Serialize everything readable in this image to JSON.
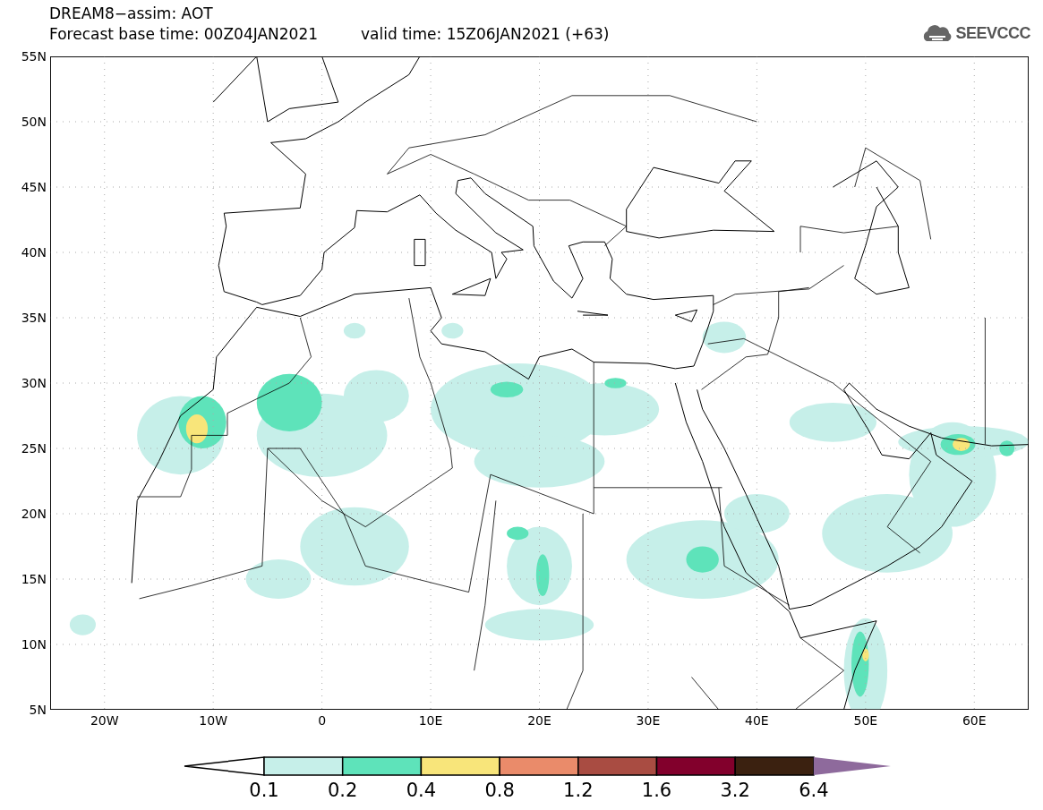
{
  "title": "DREAM8−assim: AOT",
  "base_time": "Forecast base time: 00Z04JAN2021",
  "valid_time": "valid time: 15Z06JAN2021 (+63)",
  "logo": {
    "text": "SEEVCCC"
  },
  "lat_labels": [
    "55N",
    "50N",
    "45N",
    "40N",
    "35N",
    "30N",
    "25N",
    "20N",
    "15N",
    "10N",
    "5N"
  ],
  "lon_labels": [
    "20W",
    "10W",
    "0",
    "10E",
    "20E",
    "30E",
    "40E",
    "50E",
    "60E"
  ],
  "colorbar": {
    "bins": [
      {
        "color": "#c6efe9"
      },
      {
        "color": "#5ee3ba"
      },
      {
        "color": "#f8e57a"
      },
      {
        "color": "#ea8b6a"
      },
      {
        "color": "#a94c42"
      },
      {
        "color": "#82002c"
      },
      {
        "color": "#3b2110"
      }
    ],
    "over_arrow": {
      "color": "#8e6a9c"
    },
    "labels": [
      "0.1",
      "0.2",
      "0.4",
      "0.8",
      "1.2",
      "1.6",
      "3.2",
      "6.4"
    ]
  }
}
